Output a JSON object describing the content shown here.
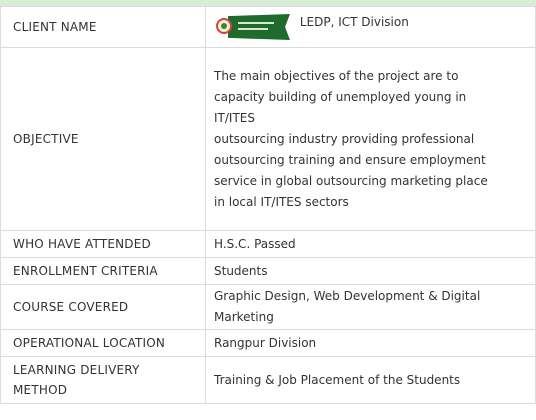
{
  "table": {
    "client": {
      "label": "CLIENT NAME",
      "value": "LEDP, ICT Division"
    },
    "objective": {
      "label": "OBJECTIVE",
      "lines": [
        "The main objectives of the project are to",
        "capacity building of unemployed young in",
        "IT/ITES",
        "outsourcing industry providing professional",
        "outsourcing training and ensure employment",
        "service in global outsourcing marketing place",
        "in local IT/ITES sectors"
      ]
    },
    "attended": {
      "label": "WHO HAVE ATTENDED",
      "value": "H.S.C. Passed"
    },
    "enrollment": {
      "label": "ENROLLMENT CRITERIA",
      "value": "Students"
    },
    "course": {
      "label": "COURSE COVERED",
      "lines": [
        "Graphic Design, Web Development & Digital",
        "Marketing"
      ]
    },
    "location": {
      "label": "OPERATIONAL LOCATION",
      "value": "Rangpur Division"
    },
    "delivery": {
      "label_lines": [
        "LEARNING DELIVERY",
        "METHOD"
      ],
      "value": "Training & Job Placement of the Students"
    }
  },
  "colors": {
    "band": "#d9ecd8",
    "border": "#dcdcdc",
    "text": "#333333",
    "logo_green": "#1f6b2e"
  }
}
